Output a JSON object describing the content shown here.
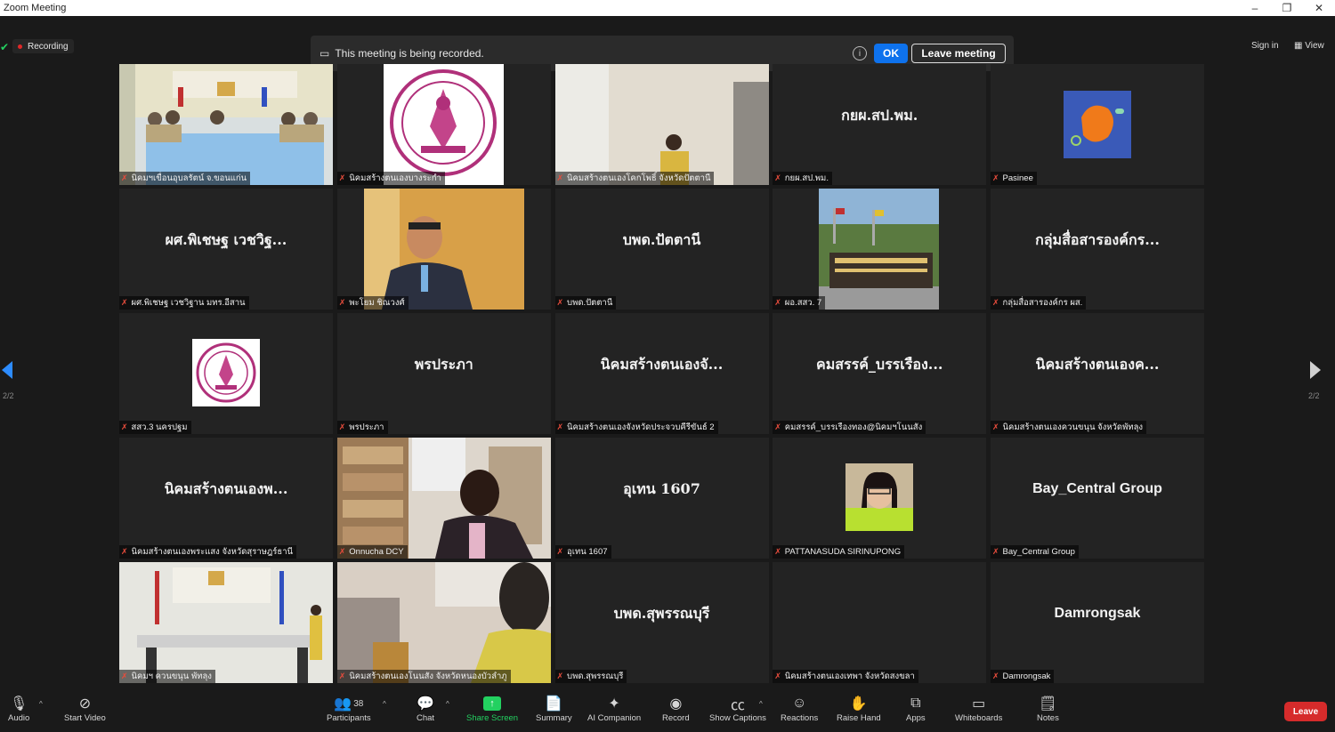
{
  "window": {
    "title": "Zoom Meeting",
    "minimize": "–",
    "restore": "❐",
    "close": "✕"
  },
  "top": {
    "recording": "Recording",
    "banner": {
      "message": "This meeting is being recorded.",
      "ok": "OK",
      "leave": "Leave meeting",
      "info": "i"
    },
    "signin": "Sign in",
    "view": "View"
  },
  "pager": {
    "left": "2/2",
    "right": "2/2"
  },
  "tiles": [
    {
      "label": "นิคมฯเขื่อนอุบลรัตน์ จ.ขอนแก่น",
      "big": ""
    },
    {
      "label": "นิคมสร้างตนเองบางระกำ",
      "big": ""
    },
    {
      "label": "นิคมสร้างตนเองโคกโพธิ์ จังหวัดปัตตานี",
      "big": ""
    },
    {
      "label": "กยผ.สป.พม.",
      "big": "กยผ.สป.พม."
    },
    {
      "label": "Pasinee",
      "big": ""
    },
    {
      "label": "ผศ.พิเชษฐ เวชวิฐาน มทร.อีสาน",
      "big": "ผศ.พิเชษฐ เวชวิฐ..."
    },
    {
      "label": "พะโยม ชิณวงศ์",
      "big": ""
    },
    {
      "label": "บพด.ปัตตานี",
      "big": "บพด.ปัตตานี"
    },
    {
      "label": "ผอ.สสว. 7",
      "big": ""
    },
    {
      "label": "กลุ่มสื่อสารองค์กร ผส.",
      "big": "กลุ่มสื่อสารองค์กร..."
    },
    {
      "label": "สสว.3 นครปฐม",
      "big": ""
    },
    {
      "label": "พรประภา",
      "big": "พรประภา"
    },
    {
      "label": "นิคมสร้างตนเองจังหวัดประจวบคีรีขันธ์ 2",
      "big": "นิคมสร้างตนเองจั..."
    },
    {
      "label": "คมสรรค์_บรรเรืองทอง@นิคมฯโนนสัง",
      "big": "คมสรรค์_บรรเรือง..."
    },
    {
      "label": "นิคมสร้างตนเองควนขนุน จังหวัดพัทลุง",
      "big": "นิคมสร้างตนเองค..."
    },
    {
      "label": "นิคมสร้างตนเองพระแสง จังหวัดสุราษฎร์ธานี",
      "big": "นิคมสร้างตนเองพ..."
    },
    {
      "label": "Onnucha DCY",
      "big": ""
    },
    {
      "label": "อุเทน 1607",
      "big": "อุเทน 1607"
    },
    {
      "label": "PATTANASUDA SIRINUPONG",
      "big": ""
    },
    {
      "label": "Bay_Central Group",
      "big": "Bay_Central Group"
    },
    {
      "label": "นิคมฯ ควนขนุน พัทลุง",
      "big": ""
    },
    {
      "label": "นิคมสร้างตนเองโนนสัง จังหวัดหนองบัวลำภู",
      "big": ""
    },
    {
      "label": "บพด.สุพรรณบุรี",
      "big": "บพด.สุพรรณบุรี"
    },
    {
      "label": "นิคมสร้างตนเองเทพา จังหวัดสงขลา",
      "big": ""
    },
    {
      "label": "Damrongsak",
      "big": "Damrongsak"
    }
  ],
  "toolbar": {
    "audio": "Audio",
    "start_video": "Start Video",
    "participants": "Participants",
    "participants_count": "38",
    "chat": "Chat",
    "share_screen": "Share Screen",
    "summary": "Summary",
    "ai_companion": "AI Companion",
    "record": "Record",
    "show_captions": "Show Captions",
    "reactions": "Reactions",
    "raise_hand": "Raise Hand",
    "apps": "Apps",
    "whiteboards": "Whiteboards",
    "notes": "Notes",
    "leave": "Leave"
  },
  "colors": {
    "accent": "#0e72ed",
    "leave": "#d62b2b",
    "share": "#23d160",
    "background": "#1a1a1a",
    "tile": "#232323"
  }
}
